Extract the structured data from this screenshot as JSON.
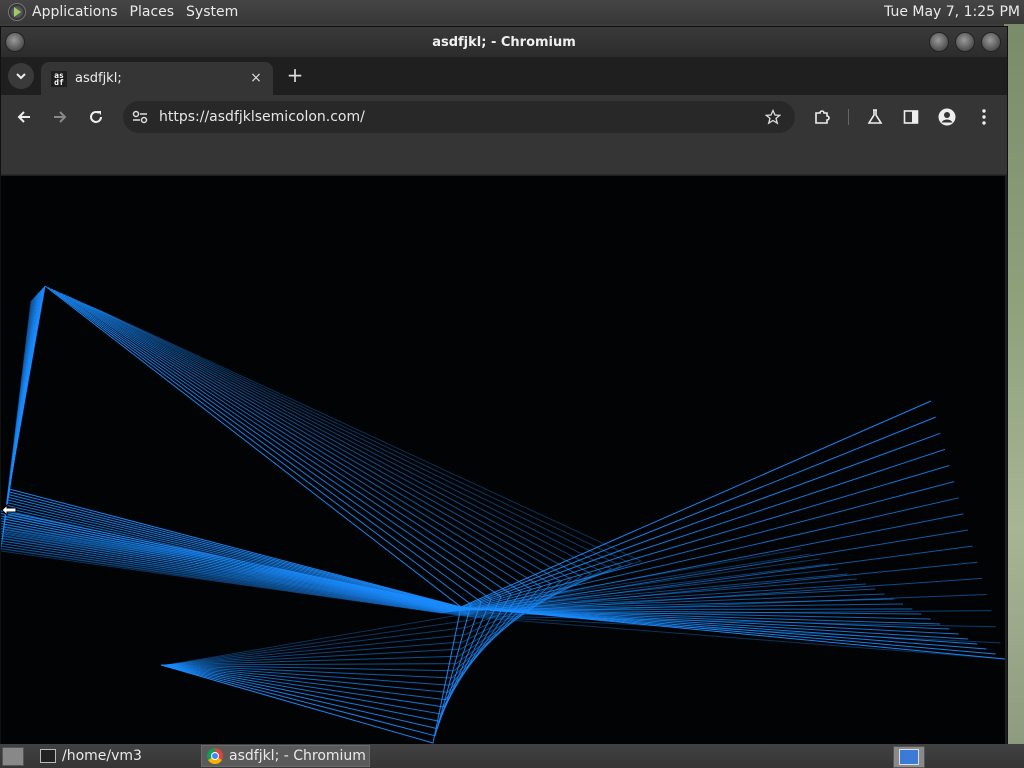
{
  "top_panel": {
    "menus": [
      "Applications",
      "Places",
      "System"
    ],
    "clock": "Tue May 7,  1:25 PM"
  },
  "window": {
    "title": "asdfjkl; - Chromium"
  },
  "browser": {
    "tab": {
      "favicon_text": "as df",
      "title": "asdfjkl;"
    },
    "new_tab_label": "+",
    "close_tab_label": "×",
    "address_bar": {
      "url": "https://asdfjklsemicolon.com/"
    },
    "accent_color": "#1a8cff"
  },
  "taskbar": {
    "tasks": [
      {
        "label": "/home/vm3",
        "icon": "terminal-icon"
      },
      {
        "label": "asdfjkl; - Chromium",
        "icon": "chromium-icon"
      }
    ]
  }
}
